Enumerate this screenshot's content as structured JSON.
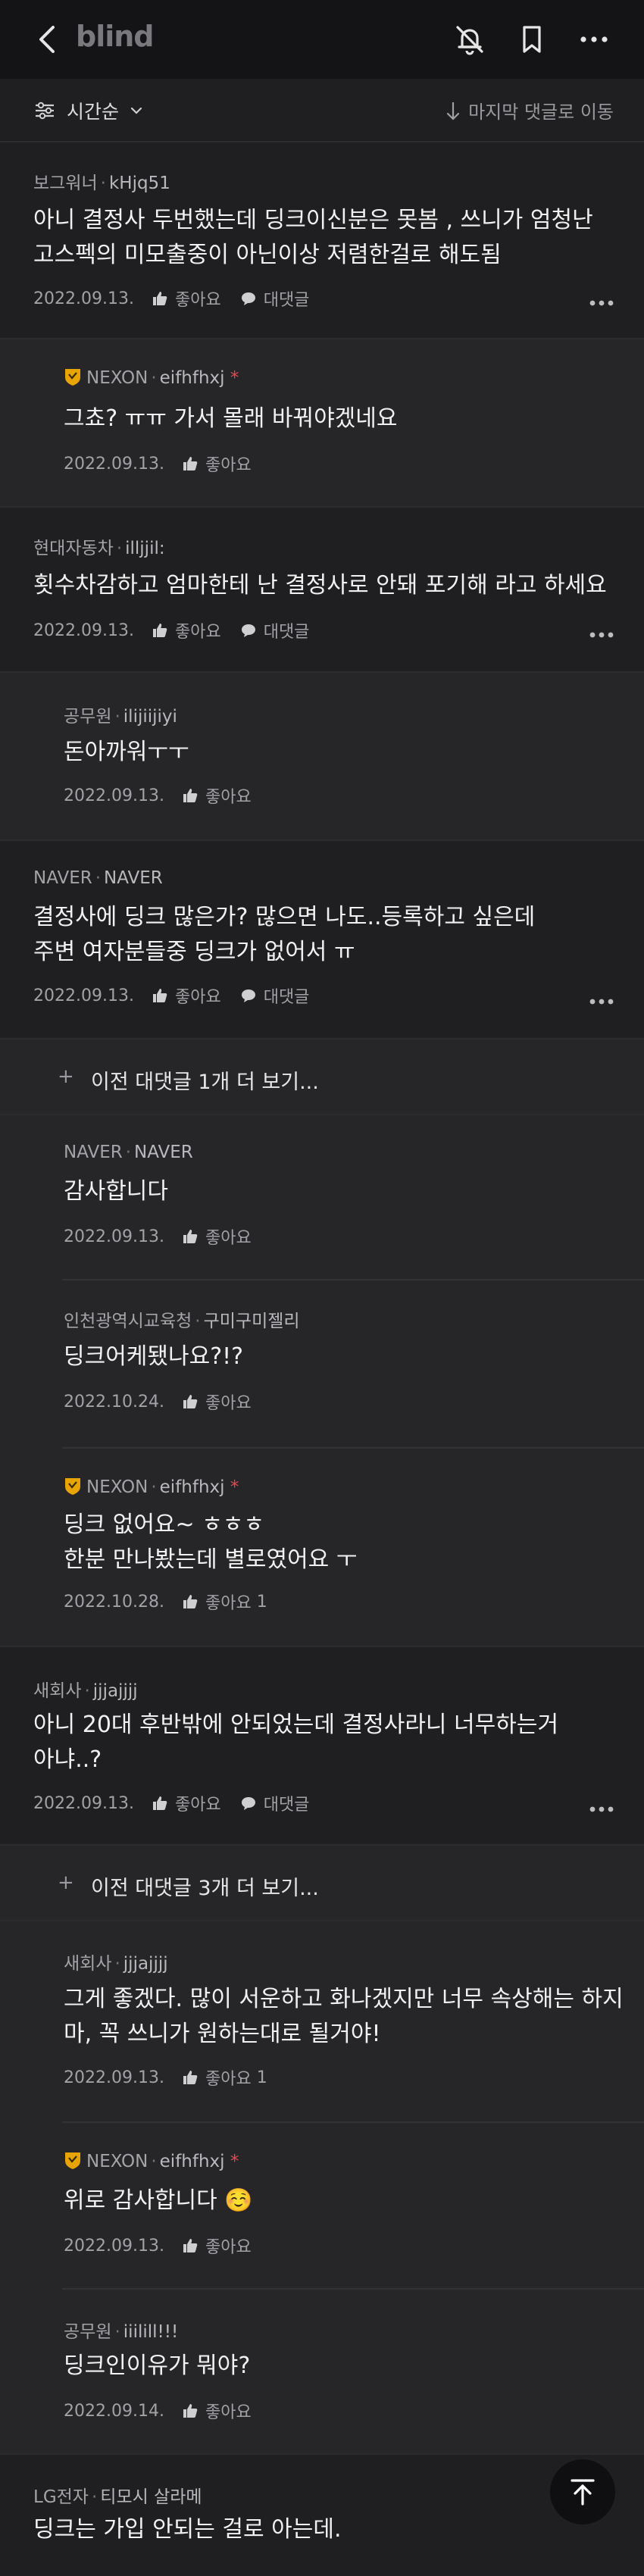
{
  "app": {
    "logo": "blind"
  },
  "sort": {
    "label": "시간순",
    "jump_label": "마지막 댓글로 이동"
  },
  "actions": {
    "like": "좋아요",
    "reply": "대댓글"
  },
  "comments": [
    {
      "company": "보그워너",
      "nick": "kHjq51",
      "lines": [
        "아니 결정사 두번했는데 딩크이신분은 못봄 , 쓰니가 엄청난",
        "고스펙의 미모출중이 아닌이상 저렴한걸로 해도됨"
      ],
      "date": "2022.09.13."
    },
    {
      "company": "NEXON",
      "nick": "eifhfhxj",
      "mark": "*",
      "lines": [
        "그쵸? ㅠㅠ 가서 몰래 바꿔야겠네요"
      ],
      "date": "2022.09.13."
    },
    {
      "company": "현대자동차",
      "nick": "illjjil:",
      "lines": [
        "횟수차감하고 엄마한테 난 결정사로 안돼 포기해 라고 하세요"
      ],
      "date": "2022.09.13."
    },
    {
      "company": "공무원",
      "nick": "ilijiijiyi",
      "lines": [
        "돈아까워ㅜㅜ"
      ],
      "date": "2022.09.13."
    },
    {
      "company": "NAVER",
      "nick": "NAVER",
      "lines": [
        "결정사에 딩크 많은가? 많으면 나도..등록하고 싶은데",
        "주변 여자분들중 딩크가 없어서 ㅠ"
      ],
      "date": "2022.09.13."
    },
    {
      "more": "이전 대댓글 1개 더 보기..."
    },
    {
      "company": "NAVER",
      "nick": "NAVER",
      "lines": [
        "감사합니다"
      ],
      "date": "2022.09.13."
    },
    {
      "company": "인천광역시교육청",
      "nick": "구미구미젤리",
      "lines": [
        "딩크어케됐나요?!?"
      ],
      "date": "2022.10.24."
    },
    {
      "company": "NEXON",
      "nick": "eifhfhxj",
      "mark": "*",
      "lines": [
        "딩크 없어요~ ㅎㅎㅎ",
        "한분 만나봤는데  별로였어요 ㅜ"
      ],
      "date": "2022.10.28.",
      "likes": "1"
    },
    {
      "company": "새회사",
      "nick": "jjjajjjj",
      "lines": [
        "아니 20대 후반밖에 안되었는데 결정사라니 너무하는거",
        "아냐..?"
      ],
      "date": "2022.09.13."
    },
    {
      "more": "이전 대댓글 3개 더 보기..."
    },
    {
      "company": "새회사",
      "nick": "jjjajjjj",
      "lines": [
        "그게 좋겠다. 많이 서운하고 화나겠지만 너무 속상해는 하지",
        "마, 꼭 쓰니가 원하는대로 될거야!"
      ],
      "date": "2022.09.13.",
      "likes": "1"
    },
    {
      "company": "NEXON",
      "nick": "eifhfhxj",
      "mark": "*",
      "lines": [
        "위로 감사합니다 ☺️"
      ],
      "date": "2022.09.13."
    },
    {
      "company": "공무원",
      "nick": "iiilill!!!",
      "lines": [
        "딩크인이유가 뭐야?"
      ],
      "date": "2022.09.14."
    },
    {
      "company": "LG전자",
      "nick": "티모시 살라메",
      "lines": [
        "딩크는 가입 안되는 걸로 아는데."
      ]
    }
  ],
  "colors": {
    "background": "#1f1f21",
    "reply_bg": "#262629",
    "badge": "#e8a400",
    "mark": "#e5484d"
  }
}
